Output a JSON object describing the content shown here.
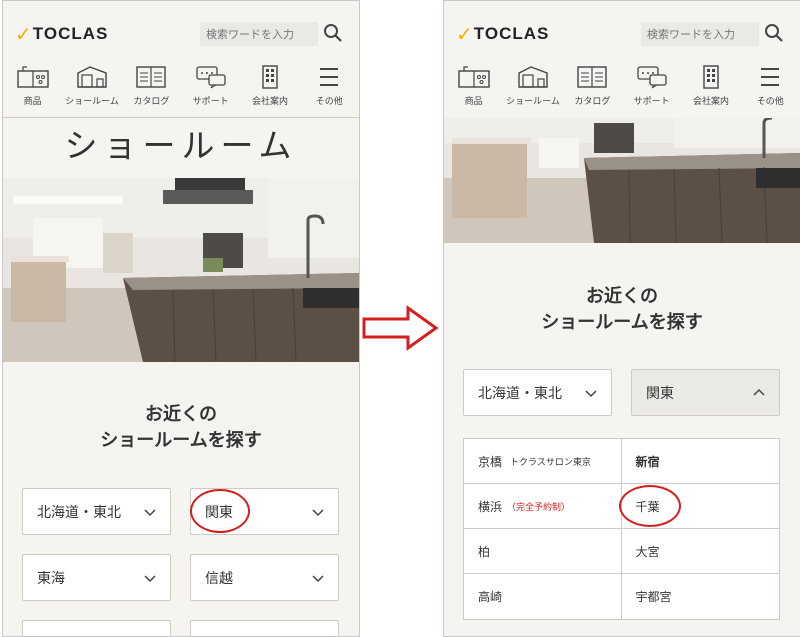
{
  "brand": {
    "name": "TOCLAS",
    "check": "✓",
    "accent": "#f0b400"
  },
  "search": {
    "placeholder": "検索ワードを入力"
  },
  "nav": [
    {
      "label": "商品",
      "icon": "kitchen-icon"
    },
    {
      "label": "ショールーム",
      "icon": "showroom-icon"
    },
    {
      "label": "カタログ",
      "icon": "catalog-icon"
    },
    {
      "label": "サポート",
      "icon": "support-icon"
    },
    {
      "label": "会社案内",
      "icon": "building-icon"
    },
    {
      "label": "その他",
      "icon": "menu-icon"
    }
  ],
  "left": {
    "page_title": "ショールーム",
    "find_title_1": "お近くの",
    "find_title_2": "ショールームを探す",
    "regions": [
      "北海道・東北",
      "関東",
      "東海",
      "信越"
    ]
  },
  "right": {
    "find_title_1": "お近くの",
    "find_title_2": "ショールームを探す",
    "regions": [
      "北海道・東北",
      "関東"
    ],
    "showrooms": [
      [
        {
          "name": "京橋",
          "sub": "トクラスサロン東京"
        },
        {
          "name": "新宿",
          "bold": true
        }
      ],
      [
        {
          "name": "横浜",
          "sub": "（完全予約制）",
          "sub_red": true
        },
        {
          "name": "千葉"
        }
      ],
      [
        {
          "name": "柏"
        },
        {
          "name": "大宮"
        }
      ],
      [
        {
          "name": "高崎"
        },
        {
          "name": "宇都宮"
        }
      ]
    ]
  },
  "colors": {
    "highlight": "#d31f1f",
    "background": "#f6f4f0"
  }
}
